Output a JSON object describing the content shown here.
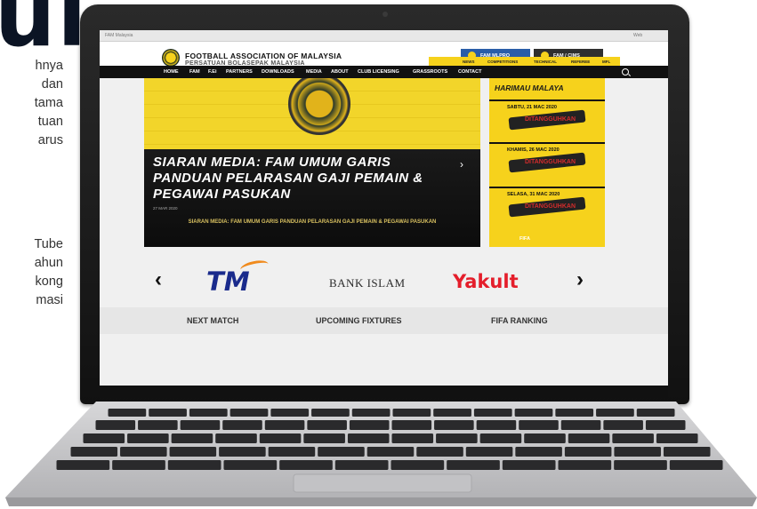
{
  "background": {
    "heading": "ul",
    "paragraph1": [
      "hnya",
      "dan",
      "tama",
      "tuan",
      "arus"
    ],
    "paragraph2": [
      "Tube",
      "ahun",
      "kong",
      "masi"
    ]
  },
  "browser": {
    "tab_text": "FAM Malaysia",
    "right_text": "Web"
  },
  "site": {
    "org_name": "FOOTBALL ASSOCIATION OF MALAYSIA",
    "org_sub": "PERSATUAN BOLASEPAK MALAYSIA",
    "social": [
      "FAM MLPRO",
      "FAM / CIMS"
    ],
    "subnav": [
      "NEWS",
      "COMPETITIONS",
      "TECHNICAL",
      "REFEREE",
      "MFL"
    ],
    "mainnav": [
      "HOME",
      "FAM",
      "F.Ei",
      "PARTNERS",
      "DOWNLOADS",
      "MEDIA",
      "ABOUT",
      "CLUB LICENSING",
      "GRASSROOTS",
      "CONTACT"
    ]
  },
  "hero": {
    "title": "SIARAN MEDIA: FAM UMUM GARIS PANDUAN PELARASAN GAJI PEMAIN & PEGAWAI PASUKAN",
    "date": "27 MAR 2020",
    "caption": "SIARAN MEDIA: FAM UMUM GARIS PANDUAN PELARASAN GAJI PEMAIN & PEGAWAI PASUKAN"
  },
  "side_panel": {
    "title": "HARIMAU MALAYA",
    "matches": [
      {
        "date": "SABTU, 21 MAC 2020",
        "label": "DITANGGUHKAN"
      },
      {
        "date": "KHAMIS, 26 MAC 2020",
        "label": "DITANGGUHKAN"
      },
      {
        "date": "SELASA, 31 MAC 2020",
        "label": "DITANGGUHKAN"
      }
    ],
    "footer": "FIFA"
  },
  "sponsors": [
    "TM",
    "BANK ISLAM",
    "Yakult"
  ],
  "tabs": [
    "NEXT MATCH",
    "UPCOMING FIXTURES",
    "FIFA RANKING"
  ],
  "colors": {
    "brand_yellow": "#f6d21c",
    "nav_black": "#111111",
    "fam_blue": "#2a5da8",
    "yakult_red": "#e41e2b",
    "tm_blue": "#1a2b8c"
  },
  "icons": {
    "prev": "chevron-left-icon",
    "next": "chevron-right-icon",
    "search": "search-icon"
  }
}
